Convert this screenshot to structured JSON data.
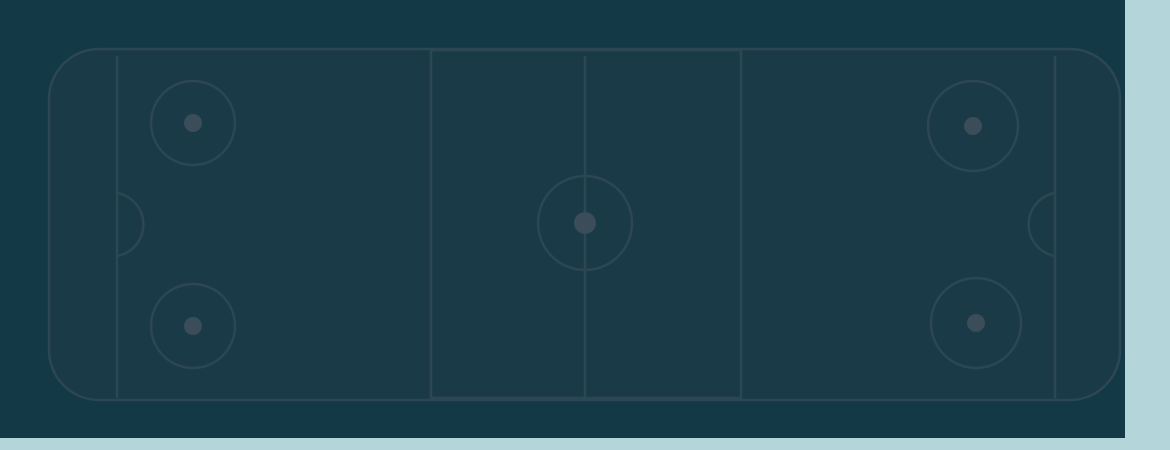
{
  "colors": {
    "page_background": "#b4d5da",
    "panel_background": "#133947",
    "rink_surface": "#1a3a48",
    "rink_lines": "#2d4654",
    "dots": "#3a4d59"
  },
  "rink": {
    "elements": [
      "boards",
      "goal-lines",
      "blue-lines",
      "center-line",
      "center-circle",
      "faceoff-circles",
      "goal-creases"
    ]
  }
}
